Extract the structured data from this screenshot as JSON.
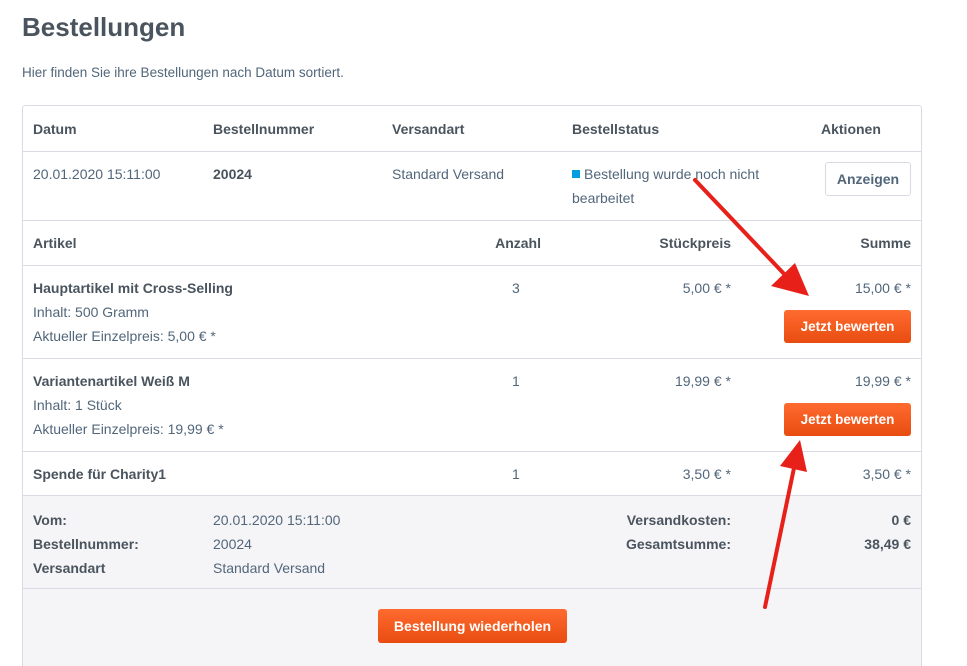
{
  "page": {
    "title": "Bestellungen",
    "subtitle": "Hier finden Sie ihre Bestellungen nach Datum sortiert."
  },
  "order_table": {
    "headers": {
      "date": "Datum",
      "number": "Bestellnummer",
      "shipping": "Versandart",
      "status": "Bestellstatus",
      "actions": "Aktionen"
    },
    "order": {
      "date": "20.01.2020 15:11:00",
      "number": "20024",
      "shipping": "Standard Versand",
      "status_line1": "Bestellung wurde noch nicht",
      "status_line2": "bearbeitet",
      "status_color": "#009ee0",
      "show_button": "Anzeigen"
    }
  },
  "article_table": {
    "headers": {
      "article": "Artikel",
      "quantity": "Anzahl",
      "unit_price": "Stückpreis",
      "sum": "Summe"
    },
    "items": [
      {
        "name": "Hauptartikel mit Cross-Selling",
        "content": "Inhalt: 500 Gramm",
        "current_price": "Aktueller Einzelpreis: 5,00 € *",
        "quantity": "3",
        "unit_price": "5,00 € *",
        "sum": "15,00 € *",
        "rate_button": "Jetzt bewerten"
      },
      {
        "name": "Variantenartikel Weiß M",
        "content": "Inhalt: 1 Stück",
        "current_price": "Aktueller Einzelpreis: 19,99 € *",
        "quantity": "1",
        "unit_price": "19,99 € *",
        "sum": "19,99 € *",
        "rate_button": "Jetzt bewerten"
      },
      {
        "name": "Spende für Charity1",
        "quantity": "1",
        "unit_price": "3,50 € *",
        "sum": "3,50 € *"
      }
    ]
  },
  "summary": {
    "from_label": "Vom:",
    "from_value": "20.01.2020 15:11:00",
    "number_label": "Bestellnummer:",
    "number_value": "20024",
    "shipping_label": "Versandart",
    "shipping_value": "Standard Versand",
    "shipping_cost_label": "Versandkosten:",
    "shipping_cost_value": "0 €",
    "total_label": "Gesamtsumme:",
    "total_value": "38,49 €"
  },
  "actions": {
    "repeat_button": "Bestellung wiederholen"
  },
  "colors": {
    "accent_button": "#e84c10",
    "annotation_arrow": "#e8201a"
  }
}
